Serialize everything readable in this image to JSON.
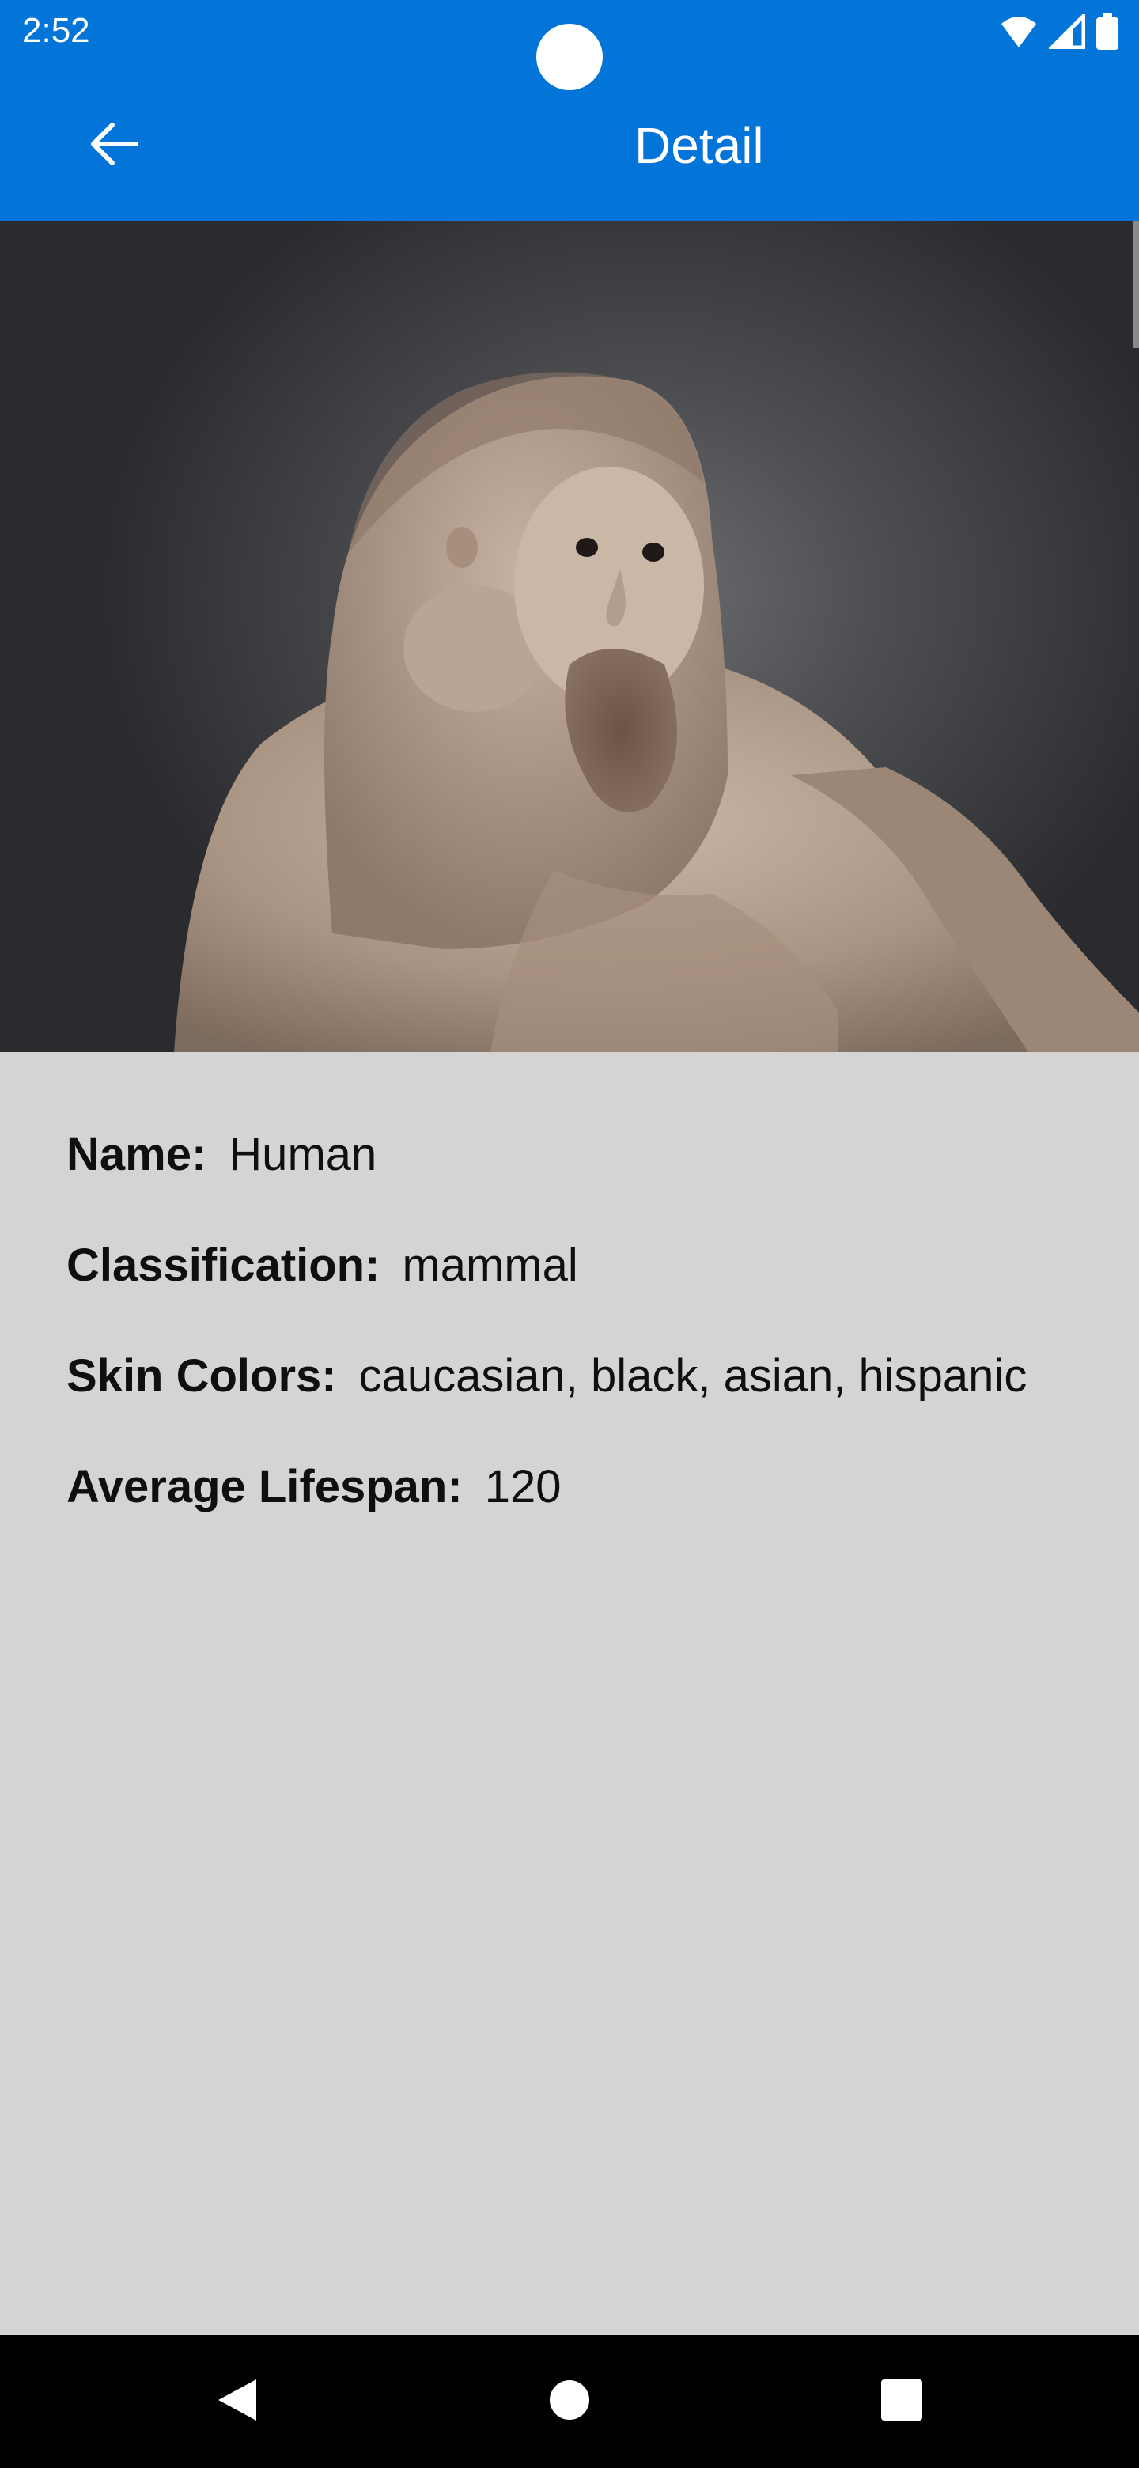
{
  "status_bar": {
    "time": "2:52",
    "icons": [
      "wifi-icon",
      "cellular-signal-icon",
      "battery-icon"
    ]
  },
  "header": {
    "title": "Detail",
    "back_icon": "arrow-left-icon",
    "background_color": "#0374d8"
  },
  "hero_image": {
    "description_icon": "creature-photo"
  },
  "details": {
    "name_label": "Name:",
    "name_value": "Human",
    "classification_label": "Classification:",
    "classification_value": "mammal",
    "skin_colors_label": "Skin Colors:",
    "skin_colors_value": "caucasian, black, asian, hispanic",
    "lifespan_label": "Average Lifespan:",
    "lifespan_value": "120"
  },
  "nav_bar": {
    "back_icon": "triangle-back-icon",
    "home_icon": "circle-home-icon",
    "recents_icon": "square-recents-icon"
  }
}
